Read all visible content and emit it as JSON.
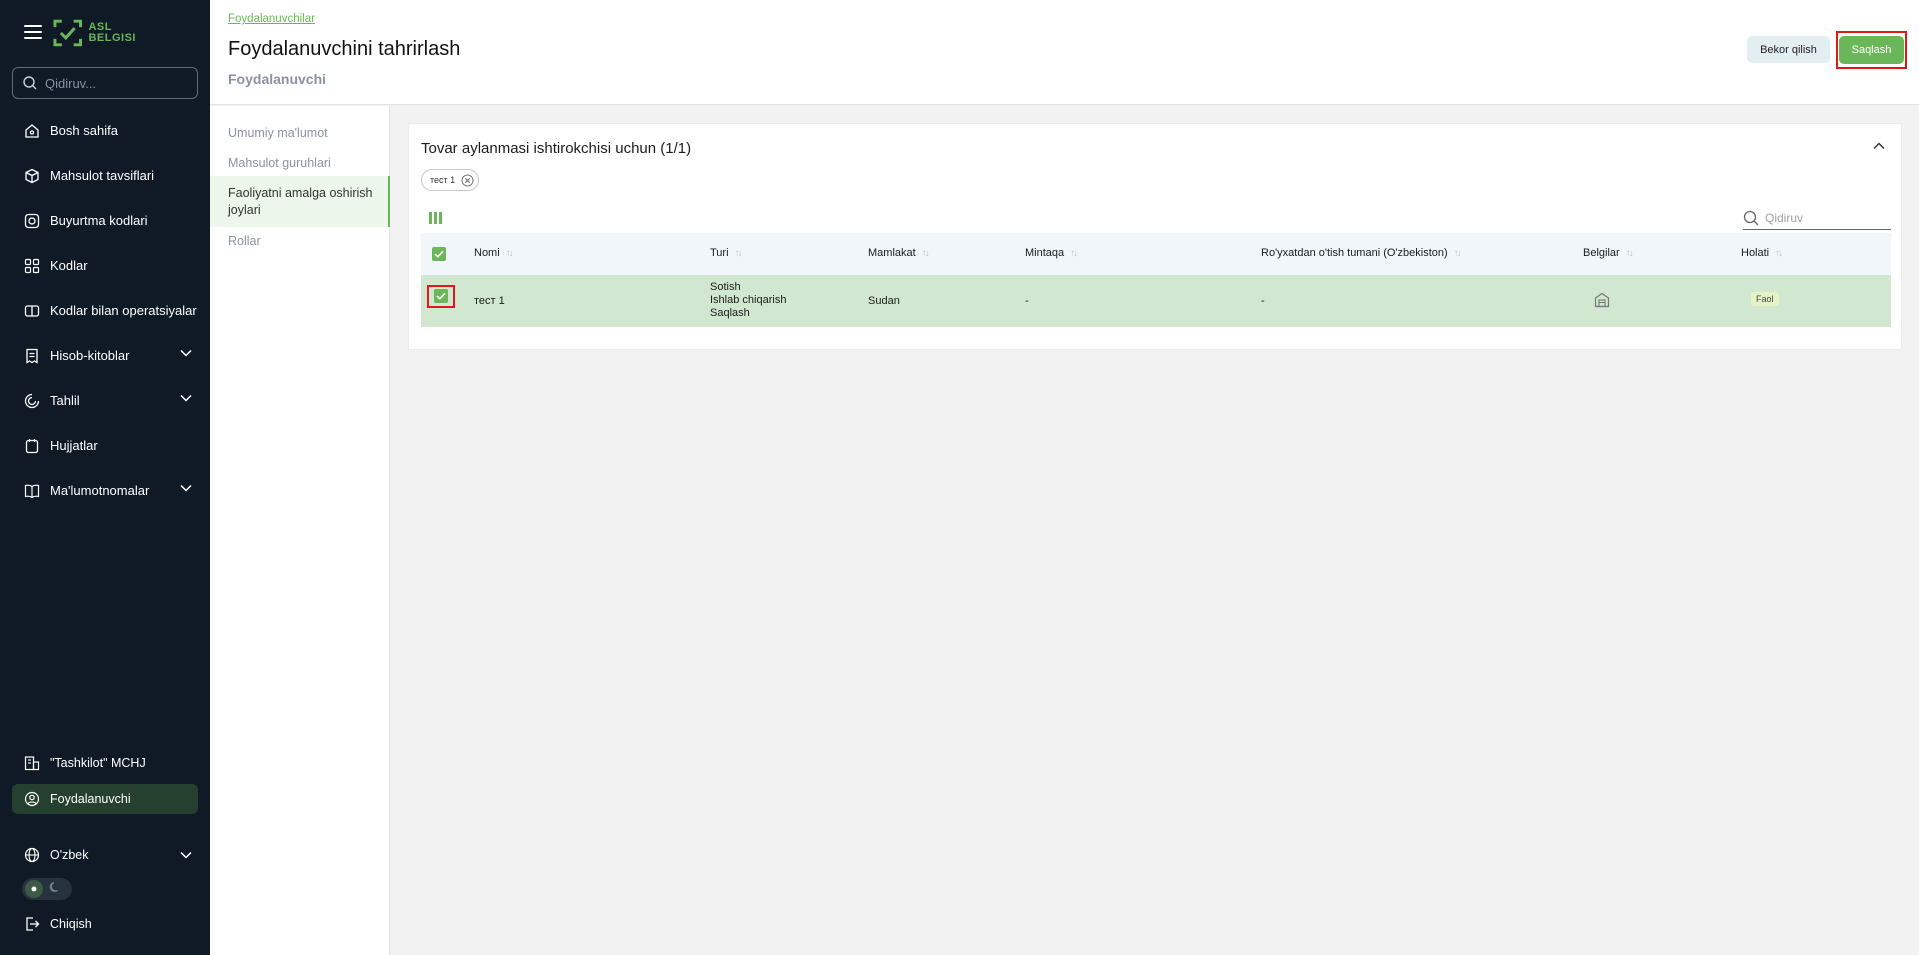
{
  "sidebar": {
    "logo_text_line1": "ASL",
    "logo_text_line2": "BELGISI",
    "search_placeholder": "Qidiruv...",
    "items": [
      {
        "label": "Bosh sahifa"
      },
      {
        "label": "Mahsulot tavsiflari"
      },
      {
        "label": "Buyurtma kodlari"
      },
      {
        "label": "Kodlar"
      },
      {
        "label": "Kodlar bilan operatsiyalar"
      },
      {
        "label": "Hisob-kitoblar"
      },
      {
        "label": "Tahlil"
      },
      {
        "label": "Hujjatlar"
      },
      {
        "label": "Ma'lumotnomalar"
      }
    ],
    "organization": "\"Tashkilot\" MCHJ",
    "user": "Foydalanuvchi",
    "language": "O'zbek",
    "logout": "Chiqish"
  },
  "header": {
    "breadcrumb": "Foydalanuvchilar",
    "title": "Foydalanuvchini tahrirlash",
    "subtitle": "Foydalanuvchi",
    "cancel_label": "Bekor qilish",
    "save_label": "Saqlash"
  },
  "subnav": {
    "items": [
      {
        "label": "Umumiy ma'lumot"
      },
      {
        "label": "Mahsulot guruhlari"
      },
      {
        "label": "Faoliyatni amalga oshirish joylari"
      },
      {
        "label": "Rollar"
      }
    ]
  },
  "card": {
    "title": "Tovar aylanmasi ishtirokchisi uchun (1/1)",
    "chip_label": "тест 1",
    "search_placeholder": "Qidiruv",
    "columns": [
      "Nomi",
      "Turi",
      "Mamlakat",
      "Mintaqa",
      "Ro'yxatdan o'tish tumani (O'zbekiston)",
      "Belgilar",
      "Holati"
    ],
    "rows": [
      {
        "name": "тест 1",
        "types": [
          "Sotish",
          "Ishlab chiqarish",
          "Saqlash"
        ],
        "country": "Sudan",
        "region": "-",
        "district": "-",
        "status": "Faol"
      }
    ]
  },
  "colors": {
    "accent": "#6cb65a",
    "sidebar_bg": "#101a27",
    "highlight": "#e01818"
  }
}
